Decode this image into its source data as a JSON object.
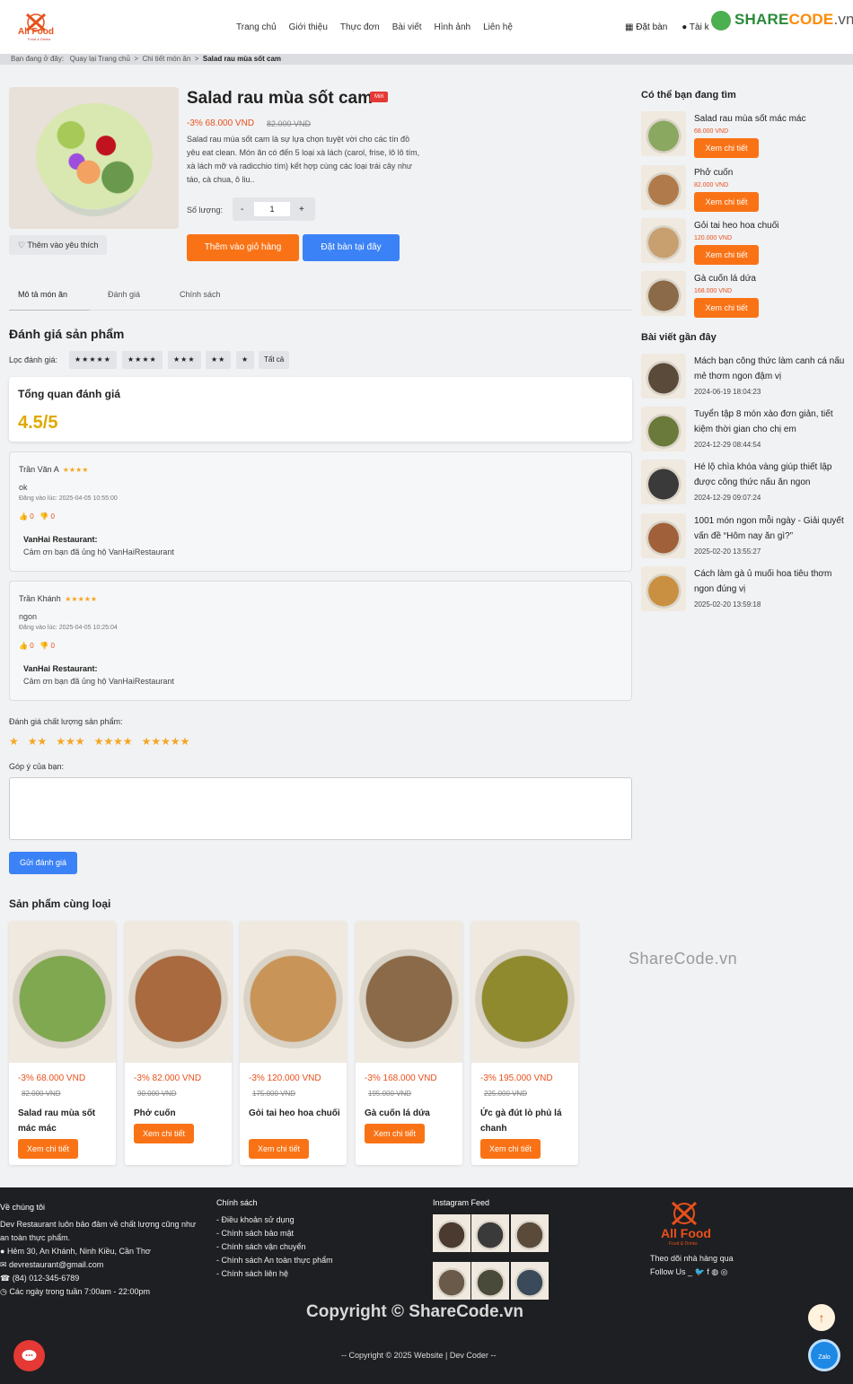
{
  "header": {
    "logo_text": "All Food",
    "logo_sub": "Food & Drinks",
    "nav": [
      "Trang chủ",
      "Giới thiệu",
      "Thực đơn",
      "Bài viết",
      "Hình ảnh",
      "Liên hệ"
    ],
    "book": "Đặt bàn",
    "account": "Tài k",
    "watermark": {
      "a": "SHARE",
      "b": "CODE",
      "c": ".vn"
    }
  },
  "breadcrumb": {
    "prefix": "Bạn đang ở đây:",
    "home": "Quay lại Trang chủ",
    "detail": "Chi tiết món ăn",
    "current": "Salad rau mùa sốt cam",
    "sep": ">"
  },
  "product": {
    "title": "Salad rau mùa sốt cam",
    "badge": "Mới",
    "price": "-3% 68.000 VND",
    "old_price": "82.000 VND",
    "description": "Salad rau mùa sốt cam là sự lựa chọn tuyệt vời cho các tín đồ yêu eat clean. Món ăn có đến 5 loại xà lách (carol, frise, lô lô tím, xà lách mỡ và radicchio tím) kết hợp cùng các loại trái cây như táo, cà chua, ô liu..",
    "qty_label": "Số lượng:",
    "qty_minus": "-",
    "qty_value": "1",
    "qty_plus": "+",
    "wishlist": "Thêm vào yêu thích",
    "add_cart": "Thêm vào giỏ hàng",
    "book_here": "Đặt bàn tại đây"
  },
  "tabs": [
    "Mô tả món ăn",
    "Đánh giá",
    "Chính sách"
  ],
  "reviews": {
    "heading": "Đánh giá sản phẩm",
    "filter_label": "Lọc đánh giá:",
    "filters": [
      "★★★★★",
      "★★★★",
      "★★★",
      "★★",
      "★",
      "Tất cả"
    ],
    "summary_title": "Tổng quan đánh giá",
    "summary_score": "4.5/5",
    "items": [
      {
        "name": "Trần Văn A",
        "stars": "★★★★",
        "text": "ok",
        "date": "Đăng vào lúc: 2025-04-05 10:55:00",
        "likes": "0",
        "dislikes": "0",
        "reply_name": "VanHai Restaurant:",
        "reply": "Cảm ơn bạn đã ủng hộ VanHaiRestaurant"
      },
      {
        "name": "Trần Khánh",
        "stars": "★★★★★",
        "text": "ngon",
        "date": "Đăng vào lúc: 2025-04-05 10:25:04",
        "likes": "0",
        "dislikes": "0",
        "reply_name": "VanHai Restaurant:",
        "reply": "Cảm ơn bạn đã ủng hộ VanHaiRestaurant"
      }
    ],
    "rate_label": "Đánh giá chất lượng sản phẩm:",
    "rate_options": [
      "★",
      "★★",
      "★★★",
      "★★★★",
      "★★★★★"
    ],
    "comment_label": "Góp ý của bạn:",
    "submit": "Gửi đánh giá"
  },
  "related": {
    "heading": "Sản phẩm cùng loại",
    "button": "Xem chi tiết",
    "items": [
      {
        "price": "-3% 68.000 VND",
        "old": "82.000 VND",
        "name": "Salad rau mùa sốt mác mác",
        "color": "#7fa850"
      },
      {
        "price": "-3% 82.000 VND",
        "old": "90.000 VND",
        "name": "Phở cuốn",
        "color": "#a86a3e"
      },
      {
        "price": "-3% 120.000 VND",
        "old": "175.000 VND",
        "name": "Gỏi tai heo hoa chuối",
        "color": "#c89458"
      },
      {
        "price": "-3% 168.000 VND",
        "old": "195.000 VND",
        "name": "Gà cuốn lá dứa",
        "color": "#8a6a48"
      },
      {
        "price": "-3% 195.000 VND",
        "old": "225.000 VND",
        "name": "Ức gà đút lò phủ lá chanh",
        "color": "#8f8a2e"
      }
    ]
  },
  "sidebar": {
    "heading": "Có thể bạn đang tìm",
    "button": "Xem chi tiết",
    "items": [
      {
        "name": "Salad rau mùa sốt mác mác",
        "price": "68.000 VND",
        "color": "#8aa860"
      },
      {
        "name": "Phở cuốn",
        "price": "82.000 VND",
        "color": "#b07a4a"
      },
      {
        "name": "Gỏi tai heo hoa chuối",
        "price": "120.000 VND",
        "color": "#c8a070"
      },
      {
        "name": "Gà cuốn lá dứa",
        "price": "168.000 VND",
        "color": "#8a6a48"
      }
    ],
    "posts_heading": "Bài viết gần đây",
    "posts": [
      {
        "title": "Mách bạn công thức làm canh cá nấu mẻ thơm ngon đậm vị",
        "date": "2024-06-19 18:04:23",
        "color": "#5a4a3a"
      },
      {
        "title": "Tuyển tập 8 món xào đơn giản, tiết kiệm thời gian cho chị em",
        "date": "2024-12-29 08:44:54",
        "color": "#6a7a3a"
      },
      {
        "title": "Hé lộ chìa khóa vàng giúp thiết lập được công thức nấu ăn ngon",
        "date": "2024-12-29 09:07:24",
        "color": "#3a3a3a"
      },
      {
        "title": "1001 món ngon mỗi ngày - Giải quyết vấn đề “Hôm nay ăn gì?”",
        "date": "2025-02-20 13:55:27",
        "color": "#a0603a"
      },
      {
        "title": "Cách làm gà ủ muối hoa tiêu thơm ngon đúng vị",
        "date": "2025-02-20 13:59:18",
        "color": "#c89040"
      }
    ]
  },
  "watermark_mid": "ShareCode.vn",
  "footer": {
    "about_h": "Về chúng tôi",
    "about": "Dev Restaurant luôn bảo đảm về chất lượng cũng như an toàn thực phẩm.",
    "address": "Hẻm 30, An Khánh, Ninh Kiều, Cần Thơ",
    "email": "devrestaurant@gmail.com",
    "phone": "(84) 012-345-6789",
    "hours": "Các ngày trong tuần 7:00am - 22:00pm",
    "policy_h": "Chính sách",
    "policies": [
      "- Điều khoản sử dụng",
      "- Chính sách bảo mật",
      "- Chính sách vận chuyển",
      "- Chính sách An toàn thực phẩm",
      "- Chính sách liên hệ"
    ],
    "insta_h": "Instagram Feed",
    "insta_colors": [
      "#4a3a30",
      "#3a3a3a",
      "#5a4a3a",
      "#2a2a2a",
      "#6a5a4a",
      "#4a4a3a",
      "#3a4a5a",
      "#5a3a2a"
    ],
    "follow1": "Theo dõi nhà hàng qua",
    "follow2": "Follow Us _",
    "copyright_big": "Copyright © ShareCode.vn",
    "copyright": "-- Copyright © 2025 Website | Dev Coder --",
    "zalo": "Zalo"
  }
}
